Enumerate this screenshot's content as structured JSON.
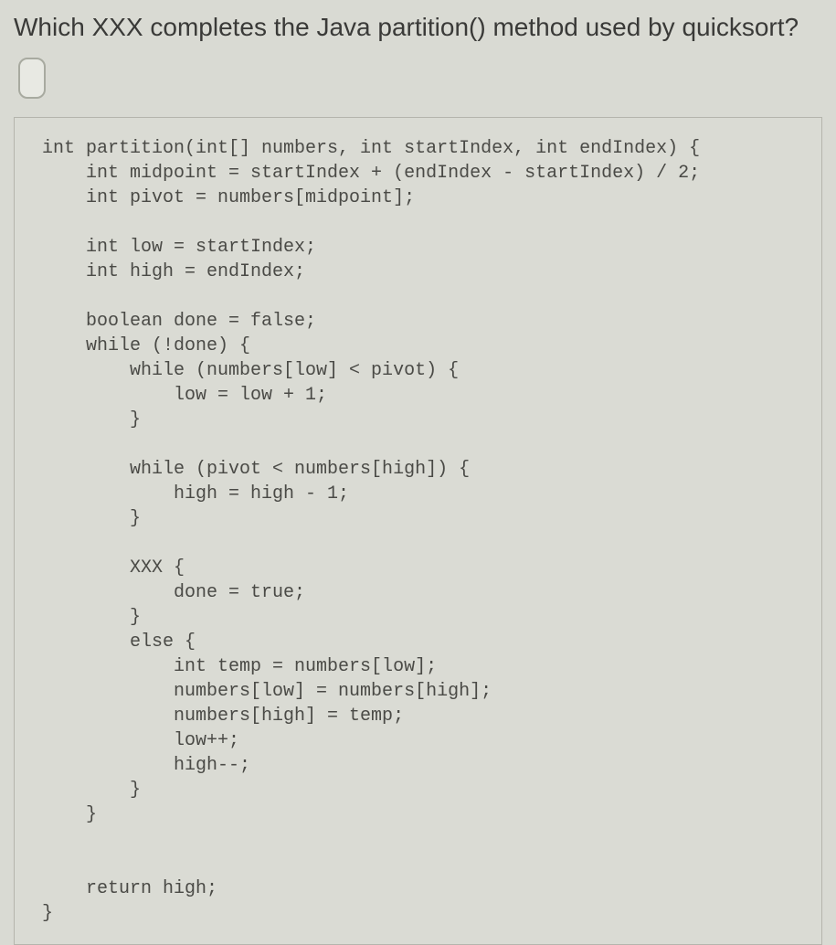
{
  "question": "Which XXX completes the Java partition() method used by quicksort?",
  "code": "int partition(int[] numbers, int startIndex, int endIndex) {\n    int midpoint = startIndex + (endIndex - startIndex) / 2;\n    int pivot = numbers[midpoint];\n\n    int low = startIndex;\n    int high = endIndex;\n\n    boolean done = false;\n    while (!done) {\n        while (numbers[low] < pivot) {\n            low = low + 1;\n        }\n\n        while (pivot < numbers[high]) {\n            high = high - 1;\n        }\n\n        XXX {\n            done = true;\n        }\n        else {\n            int temp = numbers[low];\n            numbers[low] = numbers[high];\n            numbers[high] = temp;\n            low++;\n            high--;\n        }\n    }\n\n\n    return high;\n}"
}
